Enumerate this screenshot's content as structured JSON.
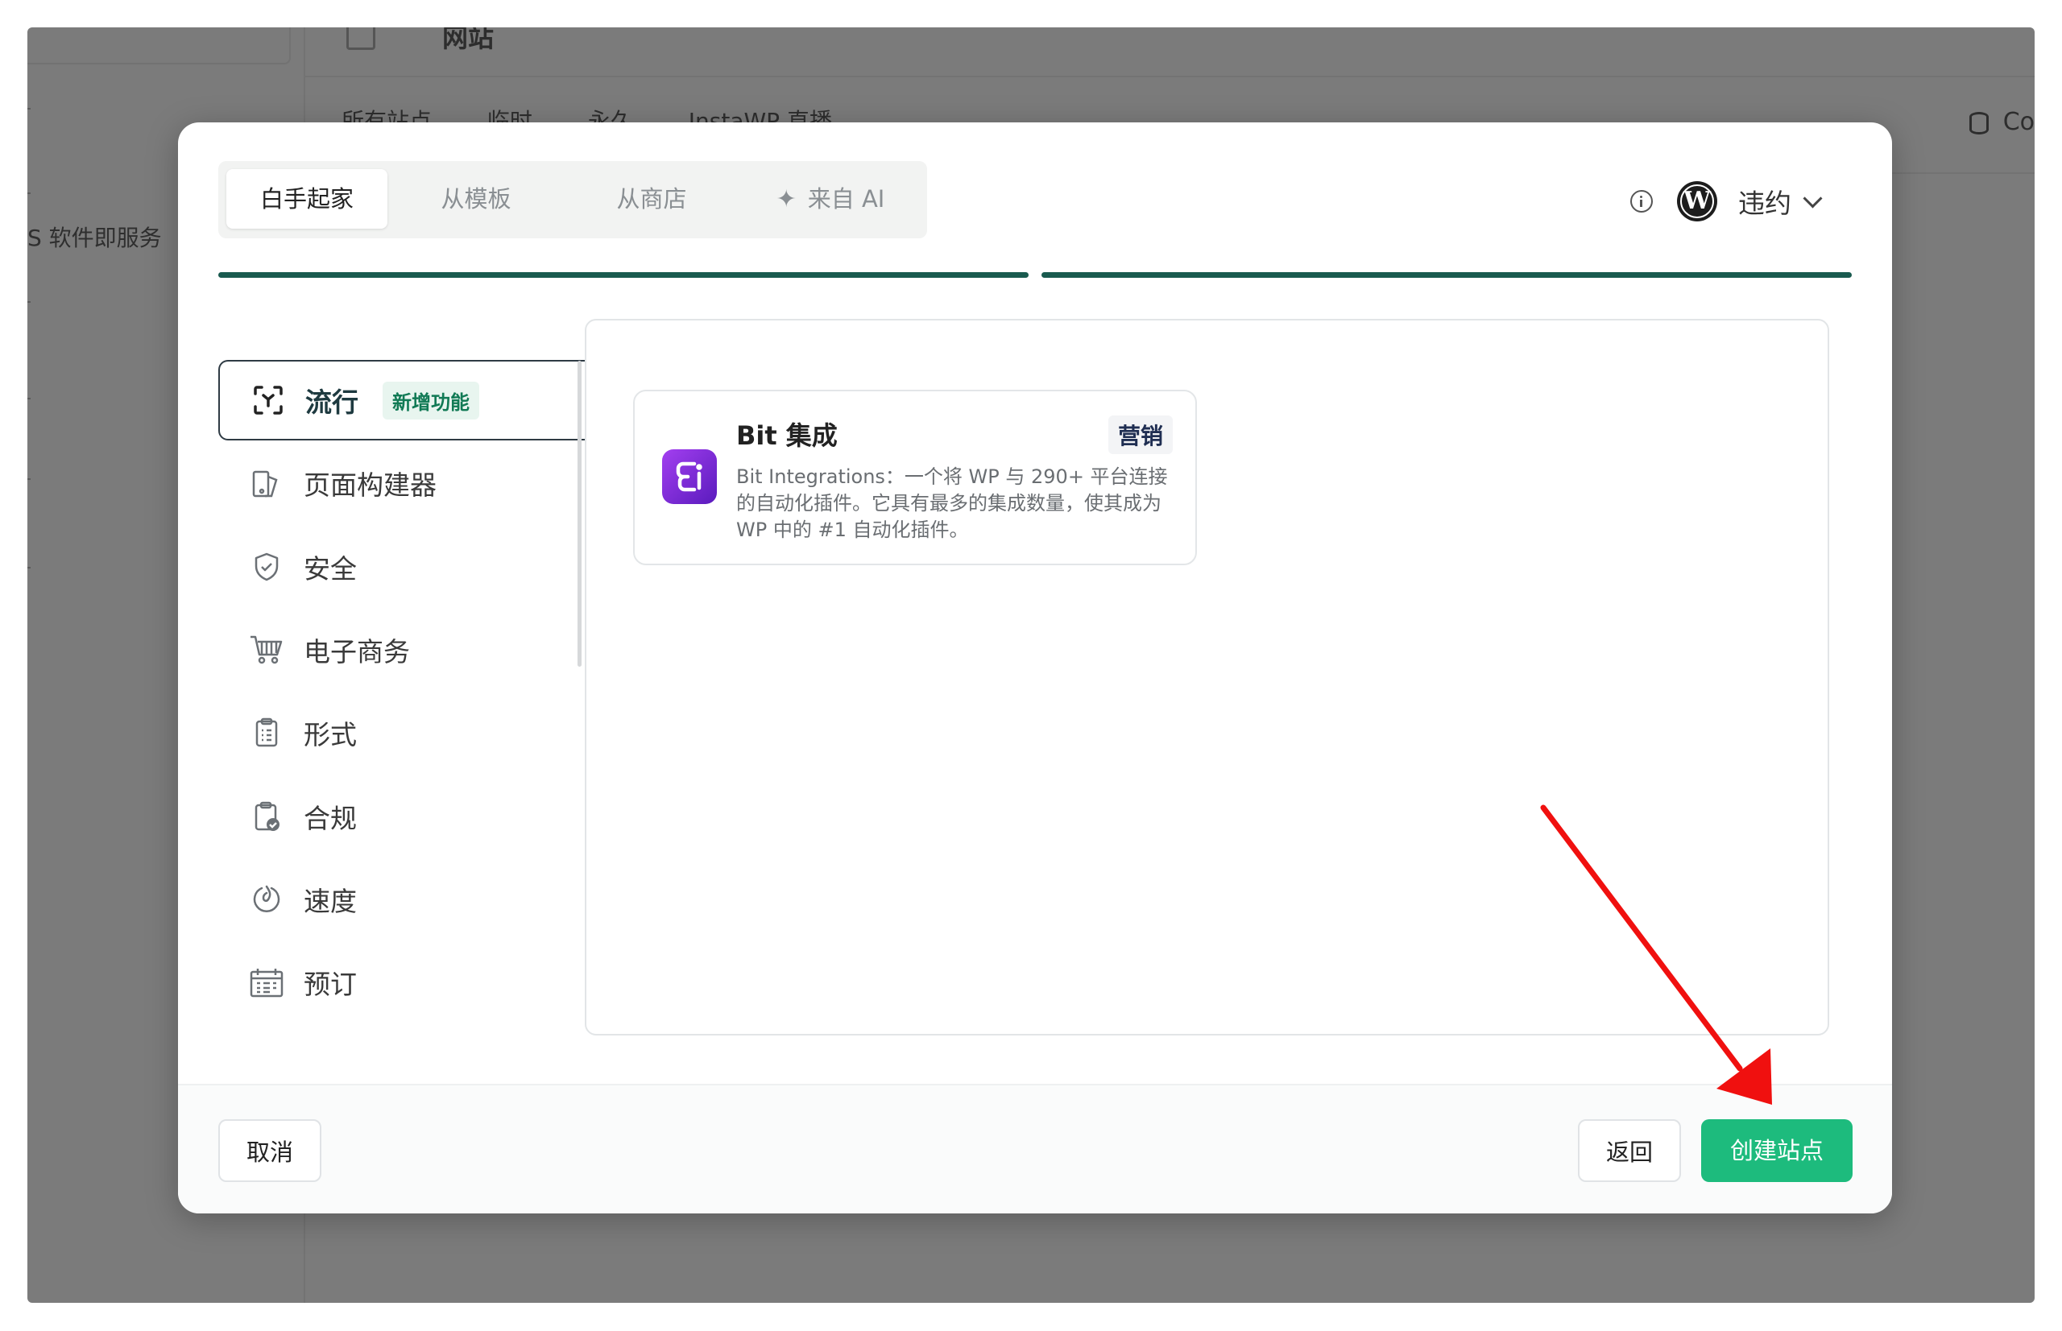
{
  "background": {
    "sidebar_text": "S 软件即服务",
    "header_title": "网站",
    "tabs": [
      "所有站点",
      "临时",
      "永久",
      "InstaWP 直播"
    ],
    "right_text": "Co"
  },
  "modal": {
    "tabs": [
      "白手起家",
      "从模板",
      "从商店",
      "来自 AI"
    ],
    "wp_label": "违约",
    "sidebar": [
      {
        "label": "流行",
        "badge": "新增功能"
      },
      {
        "label": "页面构建器"
      },
      {
        "label": "安全"
      },
      {
        "label": "电子商务"
      },
      {
        "label": "形式"
      },
      {
        "label": "合规"
      },
      {
        "label": "速度"
      },
      {
        "label": "预订"
      }
    ],
    "plugin": {
      "name": "Bit 集成",
      "tag": "营销",
      "description": "Bit Integrations：一个将 WP 与 290+ 平台连接的自动化插件。它具有最多的集成数量，使其成为 WP 中的 #1 自动化插件。"
    },
    "buttons": {
      "cancel": "取消",
      "back": "返回",
      "create": "创建站点"
    }
  },
  "colors": {
    "accent": "#1dbb7d",
    "progress": "#195a4f",
    "arrow": "#f0100f"
  }
}
